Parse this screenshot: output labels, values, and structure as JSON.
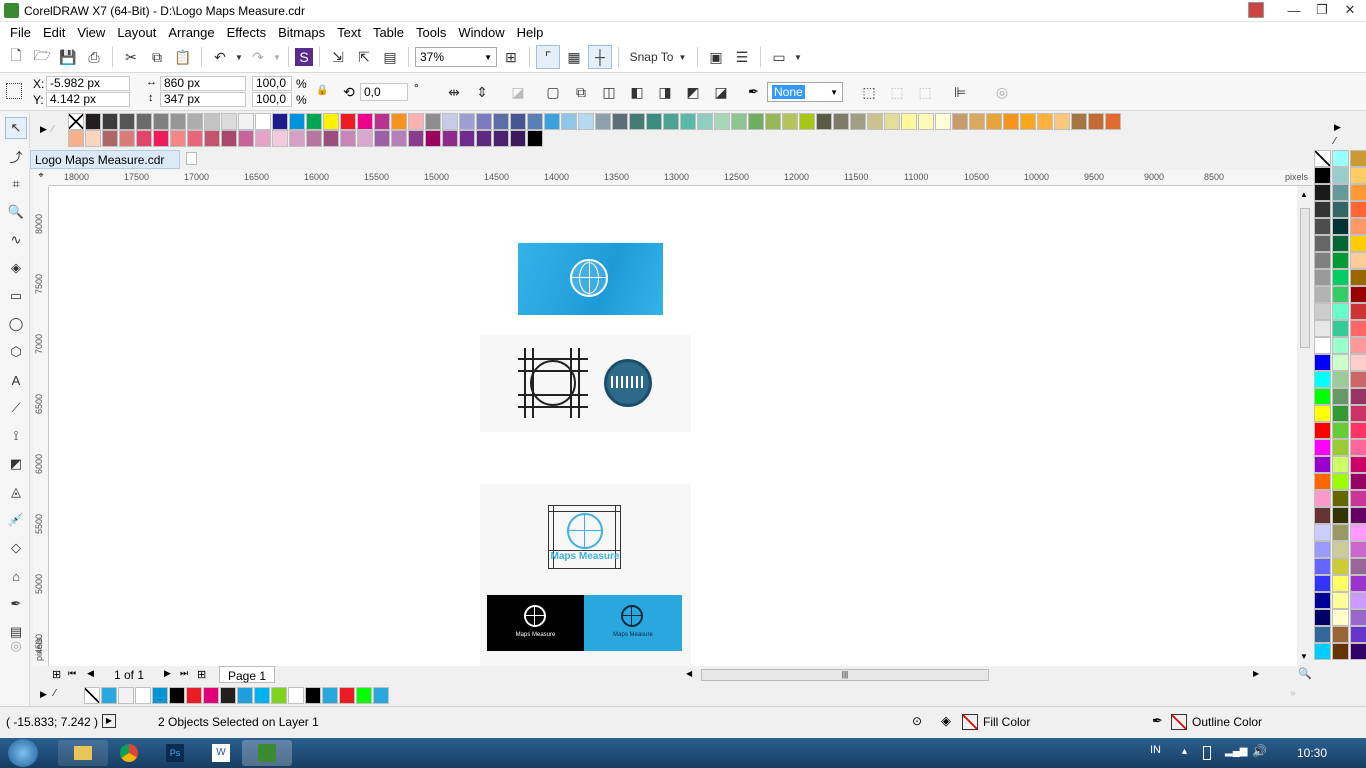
{
  "window": {
    "title": "CorelDRAW X7 (64-Bit) - D:\\Logo Maps Measure.cdr",
    "minimize": "—",
    "maximize": "❐",
    "close": "✕"
  },
  "menu": [
    "File",
    "Edit",
    "View",
    "Layout",
    "Arrange",
    "Effects",
    "Bitmaps",
    "Text",
    "Table",
    "Tools",
    "Window",
    "Help"
  ],
  "toolbar": {
    "zoom": "37%",
    "snap_to": "Snap To"
  },
  "propbar": {
    "x_label": "X:",
    "x_value": "-5.982 px",
    "y_label": "Y:",
    "y_value": "4.142 px",
    "w_value": "860 px",
    "h_value": "347 px",
    "scale_w": "100,0",
    "scale_h": "100,0",
    "pct": "%",
    "rotation": "0,0",
    "degree": "°",
    "outline": "None"
  },
  "doc_tab": "Logo Maps Measure.cdr",
  "ruler": {
    "h_ticks": [
      "18000",
      "17500",
      "17000",
      "16500",
      "16000",
      "15500",
      "15000",
      "14500",
      "14000",
      "13500",
      "13000",
      "12500",
      "12000",
      "11500",
      "11000",
      "10500",
      "10000",
      "9500",
      "9000",
      "8500"
    ],
    "h_unit": "pixels",
    "v_ticks": [
      "8000",
      "7500",
      "7000",
      "6500",
      "6000",
      "5500",
      "5000",
      "4500"
    ],
    "v_unit": "pixels"
  },
  "canvas": {
    "logo_text_1": "Maps Measure",
    "logo_text_2": "Maps Measure",
    "logo_text_3": "Maps Measure"
  },
  "pager": {
    "page_of": "1 of 1",
    "page_tab": "Page 1"
  },
  "status": {
    "coords": "( -15.833; 7.242 )",
    "selection": "2 Objects Selected on Layer 1",
    "fill": "Fill Color",
    "outline": "Outline Color"
  },
  "taskbar": {
    "lang": "IN",
    "time": "10:30"
  },
  "colors": {
    "accent_blue": "#29a8e0",
    "black": "#000000"
  }
}
